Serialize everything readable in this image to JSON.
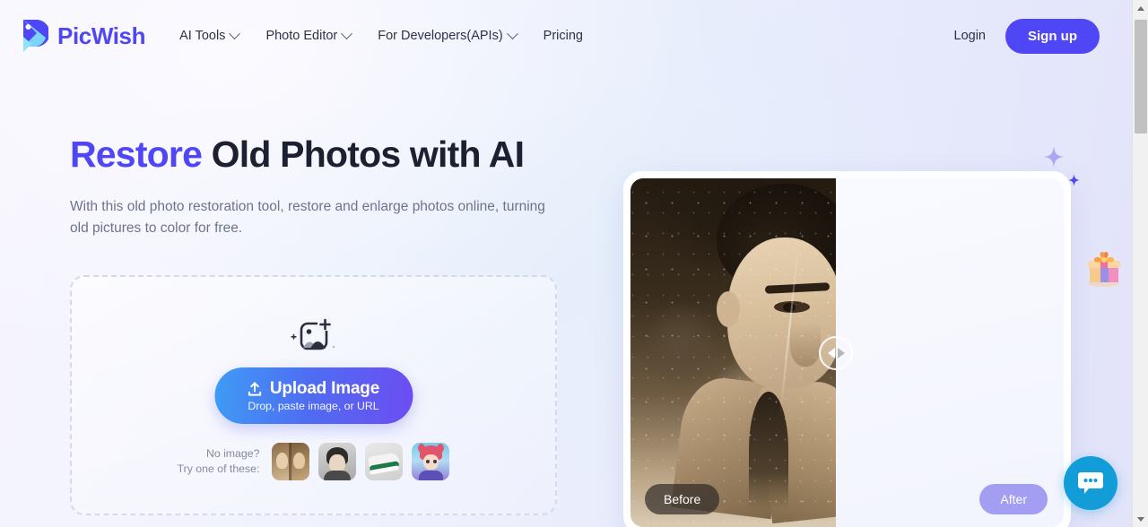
{
  "brand": {
    "name": "PicWish",
    "logo_icon": "picwish-bird-logo",
    "color": "#4f46f5"
  },
  "header": {
    "nav": [
      {
        "label": "AI Tools",
        "has_dropdown": true
      },
      {
        "label": "Photo Editor",
        "has_dropdown": true
      },
      {
        "label": "For Developers(APIs)",
        "has_dropdown": true
      },
      {
        "label": "Pricing",
        "has_dropdown": false
      }
    ],
    "login_label": "Login",
    "signup_label": "Sign up"
  },
  "hero": {
    "title_accent": "Restore",
    "title_rest": " Old Photos with AI",
    "subtitle": "With this old photo restoration tool, restore and enlarge photos online, turning old pictures to color for free."
  },
  "dropzone": {
    "icon": "add-image-icon",
    "upload_label": "Upload Image",
    "upload_hint": "Drop, paste image, or URL",
    "upload_icon": "upload-arrow-icon",
    "samples_label": "No image?\nTry one of these:",
    "samples": [
      {
        "name": "vintage-portrait-sample"
      },
      {
        "name": "young-man-portrait-sample"
      },
      {
        "name": "sneaker-sample"
      },
      {
        "name": "anime-character-sample"
      }
    ]
  },
  "comparison": {
    "before_label": "Before",
    "after_label": "After",
    "handle_icon": "slider-handle-arrows",
    "divider_position_percent": 47.5
  },
  "decor": {
    "gift_icon": "gift-box-icon",
    "sparkle_icon": "sparkle-star-icon"
  },
  "chat": {
    "icon": "chat-bubble-icon",
    "color": "#129dd8"
  },
  "scrollbar": {
    "up_icon": "scroll-up-arrow-icon",
    "down_icon": "scroll-down-arrow-icon"
  }
}
